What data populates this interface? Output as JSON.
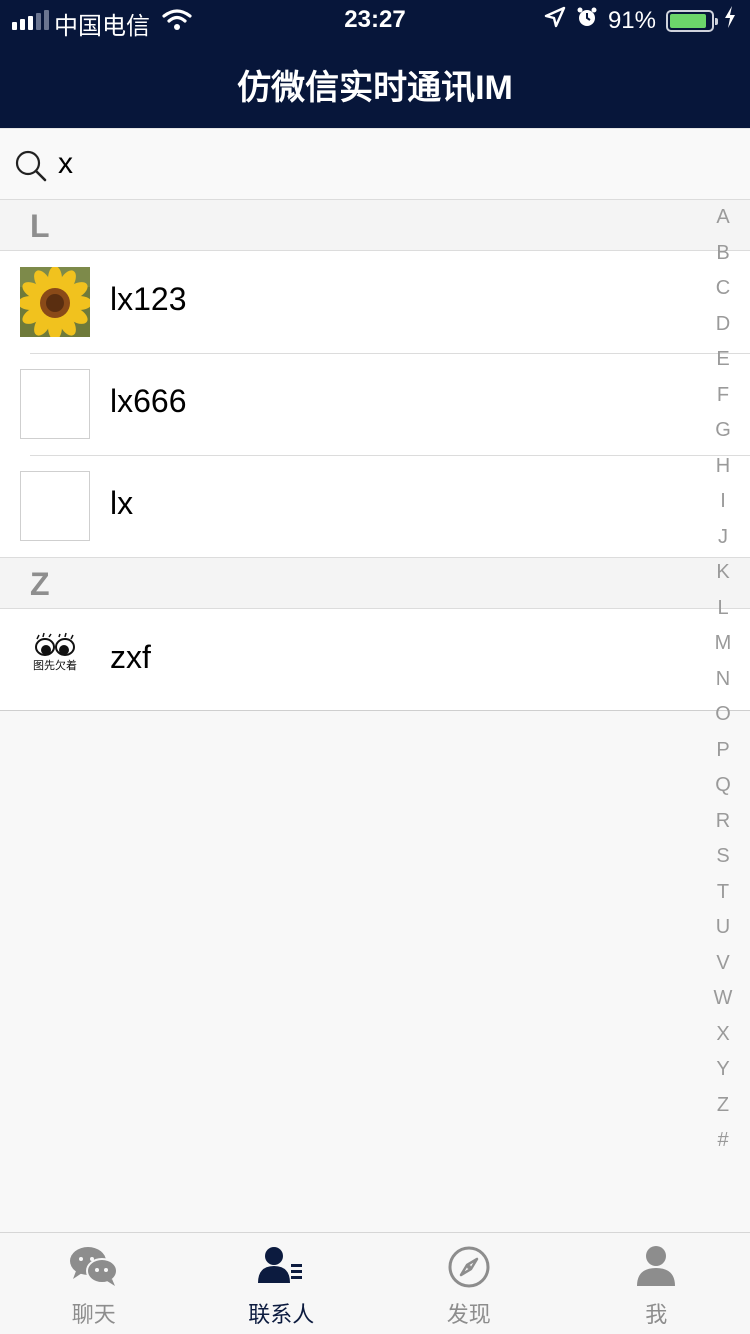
{
  "status_bar": {
    "carrier": "中国电信",
    "time": "23:27",
    "battery": "91%",
    "battery_level": 0.91
  },
  "nav": {
    "title": "仿微信实时通讯IM"
  },
  "search": {
    "icon": "search-icon",
    "value": "x"
  },
  "sections": [
    {
      "letter": "L",
      "contacts": [
        {
          "name": "lx123",
          "avatar": "sunflower-photo"
        },
        {
          "name": "lx666",
          "avatar": "blank"
        },
        {
          "name": "lx",
          "avatar": "blank"
        }
      ]
    },
    {
      "letter": "Z",
      "contacts": [
        {
          "name": "zxf",
          "avatar": "cartoon-eyes-logo",
          "avatar_text": "图先欠着"
        }
      ]
    }
  ],
  "index_letters": [
    "A",
    "B",
    "C",
    "D",
    "E",
    "F",
    "G",
    "H",
    "I",
    "J",
    "K",
    "L",
    "M",
    "N",
    "O",
    "P",
    "Q",
    "R",
    "S",
    "T",
    "U",
    "V",
    "W",
    "X",
    "Y",
    "Z",
    "#"
  ],
  "tabs": [
    {
      "label": "聊天",
      "icon": "chat-bubbles-icon",
      "active": false
    },
    {
      "label": "联系人",
      "icon": "contacts-icon",
      "active": true
    },
    {
      "label": "发现",
      "icon": "compass-icon",
      "active": false
    },
    {
      "label": "我",
      "icon": "person-icon",
      "active": false
    }
  ],
  "colors": {
    "header_bg": "#07163a",
    "active_tab": "#0c1b3f",
    "inactive_tab": "#8d8d8d"
  }
}
